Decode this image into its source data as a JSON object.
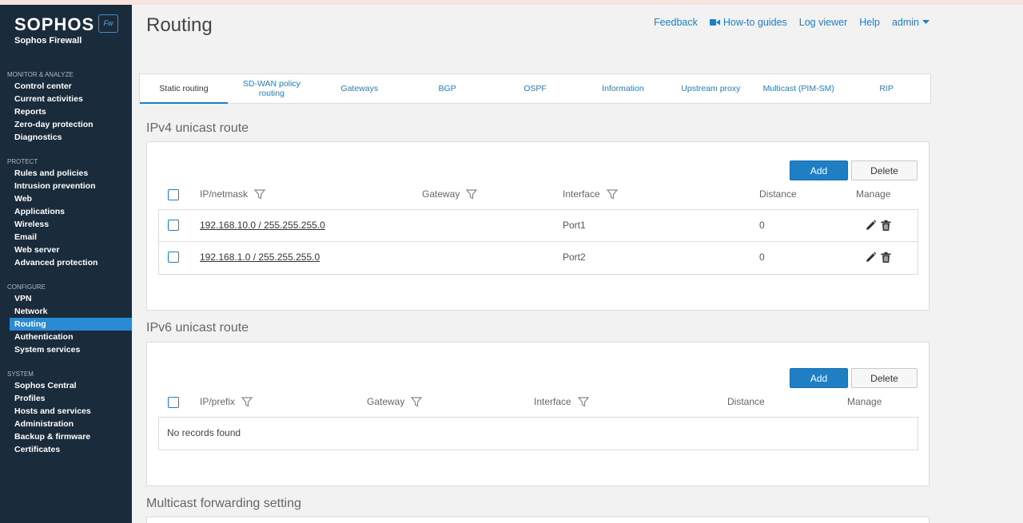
{
  "brand": {
    "name": "SOPHOS",
    "product": "Sophos Firewall",
    "badge": "Fw"
  },
  "sidebar": {
    "sections": [
      {
        "title": "MONITOR & ANALYZE",
        "items": [
          "Control center",
          "Current activities",
          "Reports",
          "Zero-day protection",
          "Diagnostics"
        ]
      },
      {
        "title": "PROTECT",
        "items": [
          "Rules and policies",
          "Intrusion prevention",
          "Web",
          "Applications",
          "Wireless",
          "Email",
          "Web server",
          "Advanced protection"
        ]
      },
      {
        "title": "CONFIGURE",
        "items": [
          "VPN",
          "Network",
          "Routing",
          "Authentication",
          "System services"
        ]
      },
      {
        "title": "SYSTEM",
        "items": [
          "Sophos Central",
          "Profiles",
          "Hosts and services",
          "Administration",
          "Backup & firmware",
          "Certificates"
        ]
      }
    ],
    "active_item": "Routing"
  },
  "header": {
    "title": "Routing",
    "links": {
      "feedback": "Feedback",
      "howto": "How-to guides",
      "logviewer": "Log viewer",
      "help": "Help",
      "user": "admin"
    }
  },
  "tabs": [
    "Static routing",
    "SD-WAN policy routing",
    "Gateways",
    "BGP",
    "OSPF",
    "Information",
    "Upstream proxy",
    "Multicast (PIM-SM)",
    "RIP"
  ],
  "active_tab": "Static routing",
  "ipv4": {
    "title": "IPv4 unicast route",
    "add_label": "Add",
    "delete_label": "Delete",
    "columns": {
      "ip": "IP/netmask",
      "gateway": "Gateway",
      "interface": "Interface",
      "distance": "Distance",
      "manage": "Manage"
    },
    "rows": [
      {
        "ip": "192.168.10.0 / 255.255.255.0",
        "gateway": "",
        "interface": "Port1",
        "distance": "0"
      },
      {
        "ip": "192.168.1.0 / 255.255.255.0",
        "gateway": "",
        "interface": "Port2",
        "distance": "0"
      }
    ]
  },
  "ipv6": {
    "title": "IPv6 unicast route",
    "add_label": "Add",
    "delete_label": "Delete",
    "columns": {
      "ip": "IP/prefix",
      "gateway": "Gateway",
      "interface": "Interface",
      "distance": "Distance",
      "manage": "Manage"
    },
    "empty_text": "No records found"
  },
  "multicast": {
    "title": "Multicast forwarding setting"
  },
  "colors": {
    "sidebar": "#1a2b3c",
    "accent": "#1f7fc4",
    "active_nav": "#2a8ad4"
  }
}
